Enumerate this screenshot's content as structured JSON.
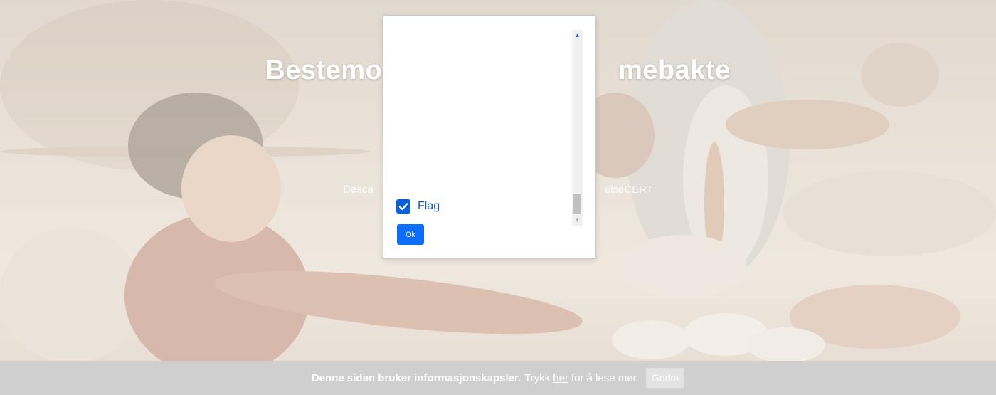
{
  "hero": {
    "title": "Bestemo                              mebakte",
    "subtitle": "Desca                                                                              elseCERT"
  },
  "modal": {
    "checkbox_label": "Flag",
    "checkbox_checked": true,
    "ok_label": "Ok",
    "accent_color": "#0d6efd",
    "scrollbar_up_icon": "▲",
    "scrollbar_down_icon": "▼"
  },
  "cookie_bar": {
    "message_bold": "Denne siden bruker informasjonskapsler.",
    "message_pre": "Trykk",
    "link_text": "her",
    "message_post": "for å lese mer.",
    "accept_label": "Godta"
  }
}
